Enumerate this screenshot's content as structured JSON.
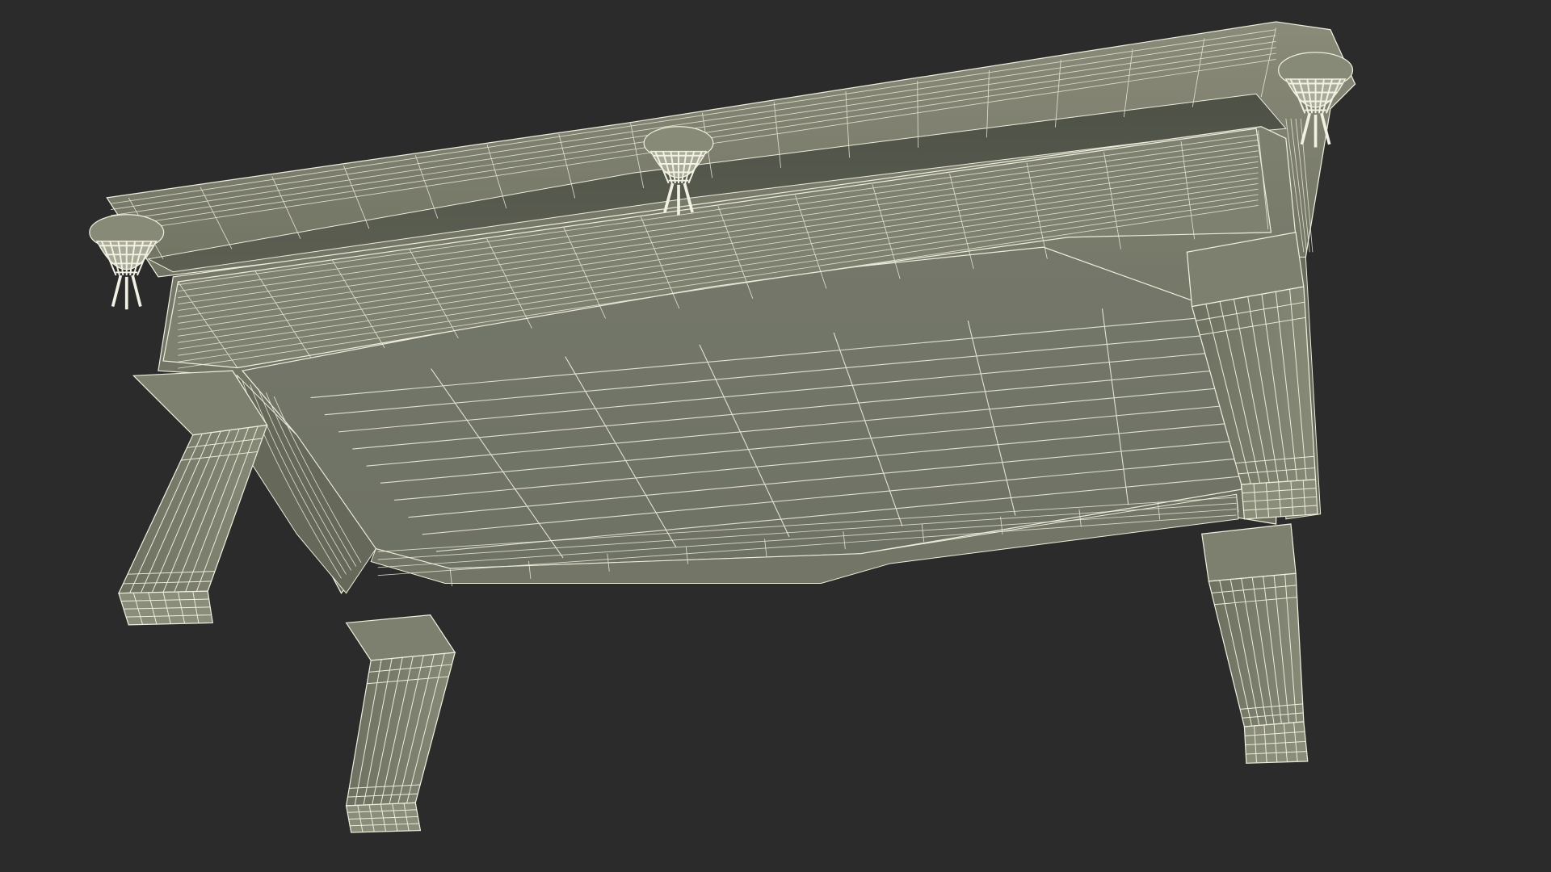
{
  "scene": {
    "subject": "pool-table-wireframe-underside",
    "background_color": "#2b2b2b",
    "surface_color": "#7b7c6c",
    "surface_dark_color": "#5b5d4e",
    "wire_color": "#efeedd",
    "pocket_net_color": "#f2f1e4"
  }
}
